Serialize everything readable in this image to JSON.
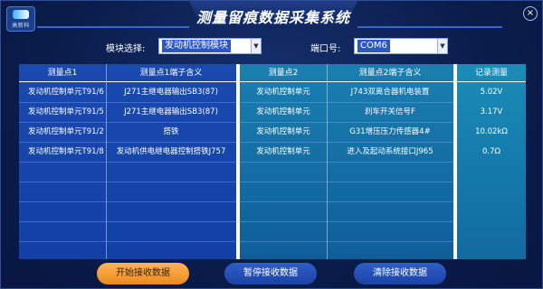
{
  "logo": {
    "text": "高新科"
  },
  "title": "测量留痕数据采集系统",
  "close_glyph": "×",
  "module": {
    "label": "模块选择:",
    "value": "发动机控制模块"
  },
  "port": {
    "label": "端口号:",
    "value": "COM6"
  },
  "table": {
    "headers": {
      "p1": "测量点1",
      "p1_desc": "测量点1端子含义",
      "p2": "测量点2",
      "p2_desc": "测量点2端子含义",
      "record": "记录测量"
    },
    "rows": [
      {
        "p1": "发动机控制单元T91/6",
        "p1_desc": "J271主继电器输出SB3(87)",
        "p2": "发动机控制单元",
        "p2_desc": "J743双离合器机电装置",
        "record": "5.02V"
      },
      {
        "p1": "发动机控制单元T91/5",
        "p1_desc": "J271主继电器输出SB3(87)",
        "p2": "发动机控制单元",
        "p2_desc": "刹车开关信号F",
        "record": "3.17V"
      },
      {
        "p1": "发动机控制单元T91/2",
        "p1_desc": "搭铁",
        "p2": "发动机控制单元",
        "p2_desc": "G31增压压力传感器4#",
        "record": "10.02kΩ"
      },
      {
        "p1": "发动机控制单元T91/8",
        "p1_desc": "发动机供电继电器控制搭铁J757",
        "p2": "发动机控制单元",
        "p2_desc": "进入及起动系统接口J965",
        "record": "0.7Ω"
      }
    ]
  },
  "buttons": {
    "start": "开始接收数据",
    "pause": "暂停接收数据",
    "clear": "清除接收数据"
  }
}
